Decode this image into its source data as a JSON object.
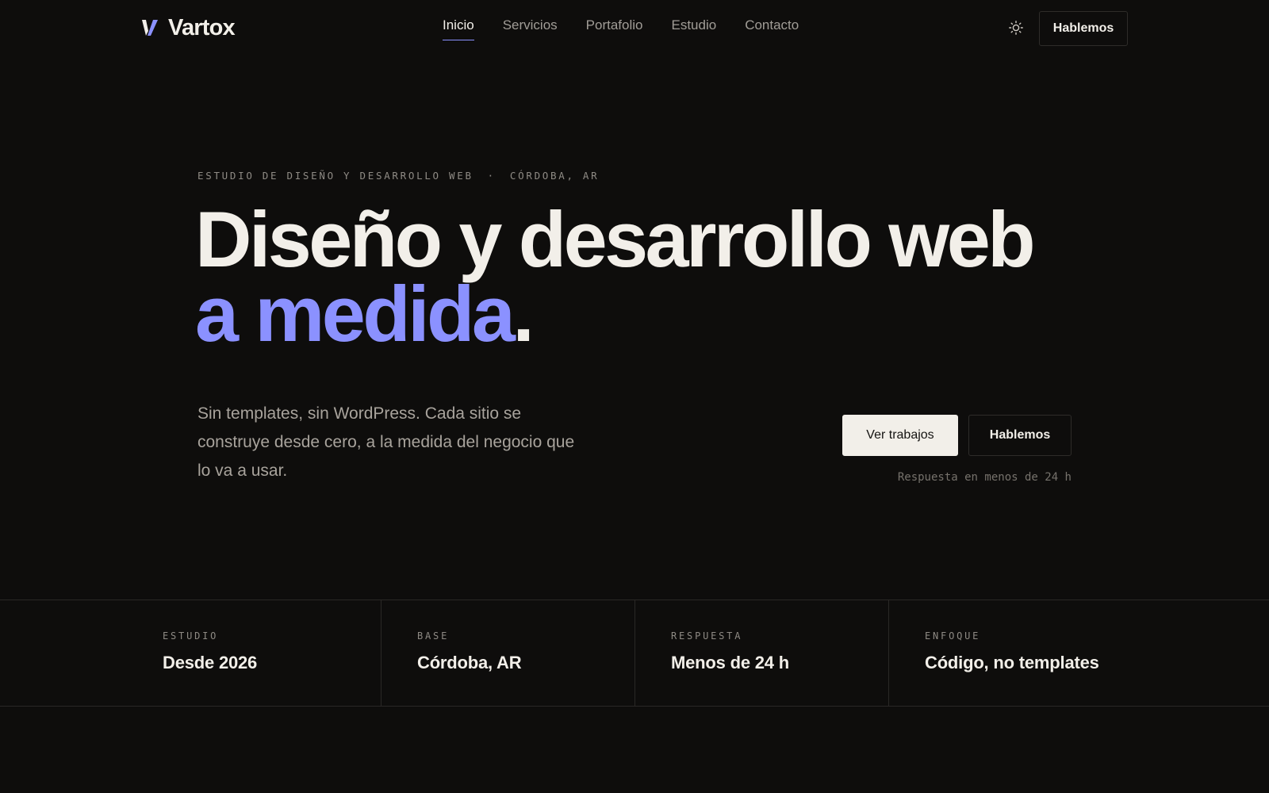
{
  "brand": {
    "name": "Vartox",
    "accent": "#8b91ff"
  },
  "nav": {
    "items": [
      {
        "label": "Inicio",
        "active": true
      },
      {
        "label": "Servicios",
        "active": false
      },
      {
        "label": "Portafolio",
        "active": false
      },
      {
        "label": "Estudio",
        "active": false
      },
      {
        "label": "Contacto",
        "active": false
      }
    ],
    "theme_icon": "sun-icon",
    "cta_label": "Hablemos"
  },
  "hero": {
    "eyebrow_left": "ESTUDIO DE DISEÑO Y DESARROLLO WEB",
    "eyebrow_sep": "·",
    "eyebrow_right": "CÓRDOBA, AR",
    "headline_line1": "Diseño y desarrollo web",
    "headline_accent": "a medida",
    "headline_period": ".",
    "lead": "Sin templates, sin WordPress. Cada sitio se construye desde cero, a la medida del negocio que lo va a usar.",
    "primary_cta": "Ver trabajos",
    "secondary_cta": "Hablemos",
    "response_note": "Respuesta en menos de 24 h"
  },
  "stats": [
    {
      "label": "ESTUDIO",
      "value": "Desde 2026"
    },
    {
      "label": "BASE",
      "value": "Córdoba, AR"
    },
    {
      "label": "RESPUESTA",
      "value": "Menos de 24 h"
    },
    {
      "label": "ENFOQUE",
      "value": "Código, no templates"
    }
  ],
  "colors": {
    "background": "#0e0d0c",
    "text": "#f2efe9",
    "muted": "#a19d97",
    "accent": "#8b91ff",
    "border": "#2a2826"
  }
}
